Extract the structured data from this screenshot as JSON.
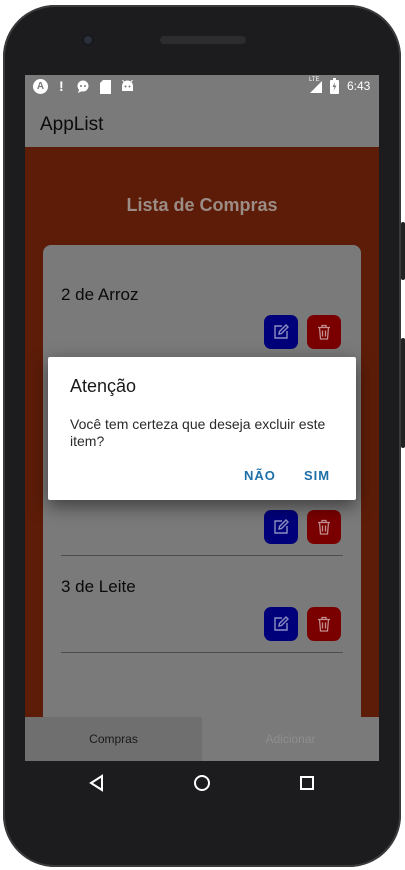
{
  "status_bar": {
    "time": "6:43",
    "left_icons": [
      "a-icon",
      "alert-icon",
      "chat-icon",
      "sd-card-icon",
      "android-icon"
    ],
    "network": "LTE"
  },
  "app_bar": {
    "title": "AppList"
  },
  "list": {
    "title": "Lista de Compras",
    "items": [
      {
        "label": "2 de Arroz"
      },
      {
        "label": ""
      },
      {
        "label": "3 de Leite"
      }
    ]
  },
  "dialog": {
    "title": "Atenção",
    "message": "Você tem certeza que deseja excluir este item?",
    "cancel_label": "NÃO",
    "confirm_label": "SIM"
  },
  "tabs": [
    {
      "label": "Compras",
      "active": true
    },
    {
      "label": "Adicionar",
      "active": false
    }
  ],
  "colors": {
    "content_bg": "#5c1c08",
    "edit_button": "#00007a",
    "delete_button": "#7a0000",
    "dialog_action": "#1e6fa8"
  }
}
